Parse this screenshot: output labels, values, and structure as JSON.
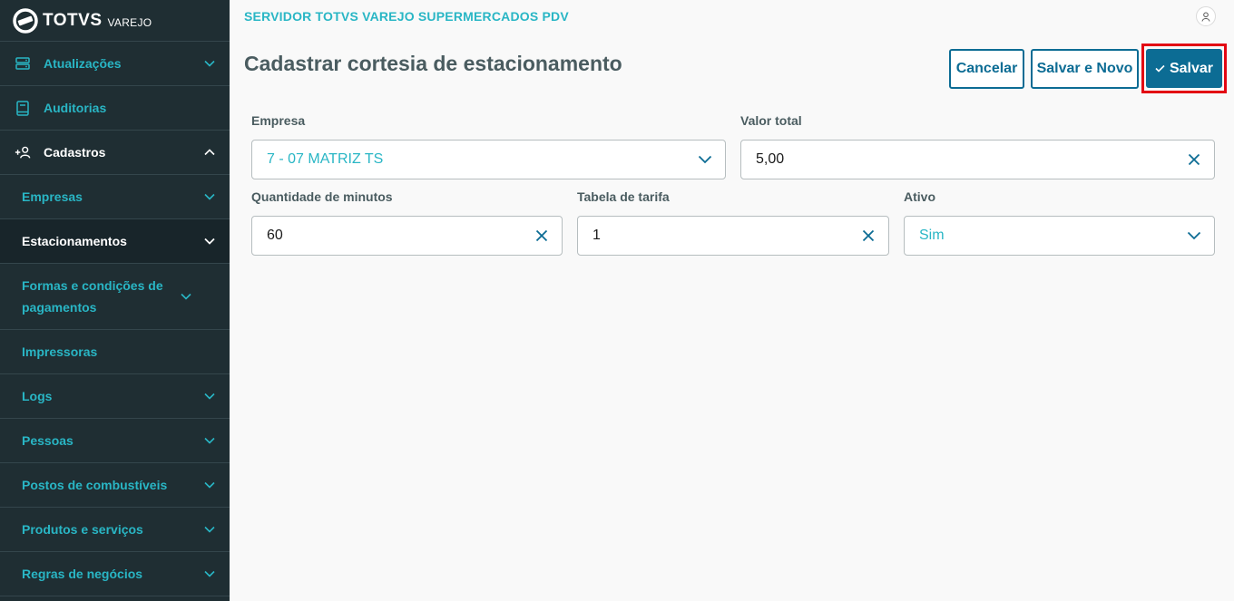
{
  "brand": {
    "name": "TOTVS",
    "sub": "VAREJO"
  },
  "sidebar": {
    "top_items": [
      {
        "label": "Atualizações",
        "icon": "server-icon"
      },
      {
        "label": "Auditorias",
        "icon": "book-icon"
      },
      {
        "label": "Cadastros",
        "icon": "add-user-icon"
      }
    ],
    "sub_items": [
      {
        "label": "Empresas"
      },
      {
        "label": "Estacionamentos"
      },
      {
        "label": "Formas e condições de pagamentos"
      },
      {
        "label": "Impressoras"
      },
      {
        "label": "Logs"
      },
      {
        "label": "Pessoas"
      },
      {
        "label": "Postos de combustíveis"
      },
      {
        "label": "Produtos e serviços"
      },
      {
        "label": "Regras de negócios"
      }
    ]
  },
  "header": {
    "server_title": "SERVIDOR TOTVS VAREJO SUPERMERCADOS PDV"
  },
  "page": {
    "title": "Cadastrar cortesia de estacionamento"
  },
  "actions": {
    "cancel": "Cancelar",
    "save_new": "Salvar e Novo",
    "save": "Salvar"
  },
  "form": {
    "empresa": {
      "label": "Empresa",
      "value": "7 - 07 MATRIZ TS"
    },
    "valor_total": {
      "label": "Valor total",
      "value": "5,00"
    },
    "quantidade": {
      "label": "Quantidade de minutos",
      "value": "60"
    },
    "tabela": {
      "label": "Tabela de tarifa",
      "value": "1"
    },
    "ativo": {
      "label": "Ativo",
      "value": "Sim"
    }
  },
  "colors": {
    "sidebar_bg": "#1f2e33",
    "accent": "#29b6c5",
    "primary": "#0c6c94",
    "highlight": "#e30613"
  }
}
